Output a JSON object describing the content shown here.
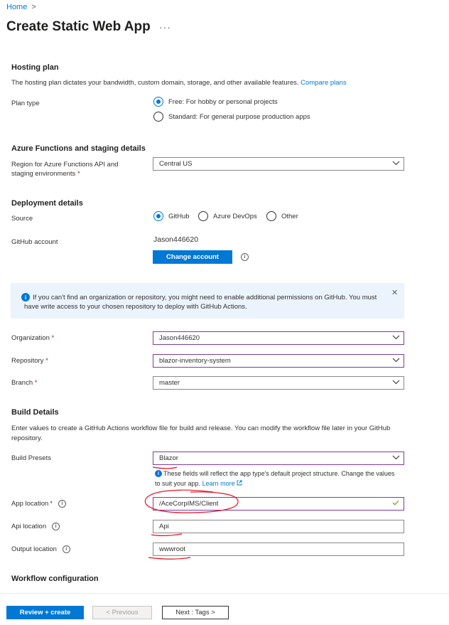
{
  "breadcrumb": {
    "home": "Home",
    "separator": ">"
  },
  "page": {
    "title": "Create Static Web App",
    "more": "···"
  },
  "hosting": {
    "title": "Hosting plan",
    "desc": "The hosting plan dictates your bandwidth, custom domain, storage, and other available features.",
    "compare_link": "Compare plans",
    "plan_type_label": "Plan type",
    "options": [
      "Free: For hobby or personal projects",
      "Standard: For general purpose production apps"
    ],
    "selected": "Free: For hobby or personal projects"
  },
  "functions": {
    "title": "Azure Functions and staging details",
    "region_label_line1": "Region for Azure Functions API and",
    "region_label_line2": "staging environments",
    "region_value": "Central US"
  },
  "deployment": {
    "title": "Deployment details",
    "source_label": "Source",
    "sources": [
      "GitHub",
      "Azure DevOps",
      "Other"
    ],
    "selected_source": "GitHub",
    "github_account_label": "GitHub account",
    "github_account": "Jason446620",
    "change_account": "Change account"
  },
  "banner": {
    "text": "If you can't find an organization or repository, you might need to enable additional permissions on GitHub. You must have write access to your chosen repository to deploy with GitHub Actions.",
    "close": "✕"
  },
  "repo": {
    "org_label": "Organization",
    "org_value": "Jason446620",
    "repo_label": "Repository",
    "repo_value": "blazor-inventory-system",
    "branch_label": "Branch",
    "branch_value": "master"
  },
  "build": {
    "title": "Build Details",
    "desc": "Enter values to create a GitHub Actions workflow file for build and release. You can modify the workflow file later in your GitHub repository.",
    "presets_label": "Build Presets",
    "presets_value": "Blazor",
    "hint": "These fields will reflect the app type's default project structure. Change the values to suit your app.",
    "learn_more": "Learn more",
    "app_location_label": "App location",
    "app_location_value": "/AceCorpIMS/Client",
    "api_location_label": "Api location",
    "api_location_value": "Api",
    "output_location_label": "Output location",
    "output_location_value": "wwwroot"
  },
  "workflow": {
    "title": "Workflow configuration"
  },
  "footer": {
    "review_create": "Review + create",
    "previous": "< Previous",
    "next": "Next : Tags >"
  },
  "colors": {
    "accent": "#0078d4",
    "annotation": "#e81123",
    "focus_border": "#7f3b9e"
  }
}
